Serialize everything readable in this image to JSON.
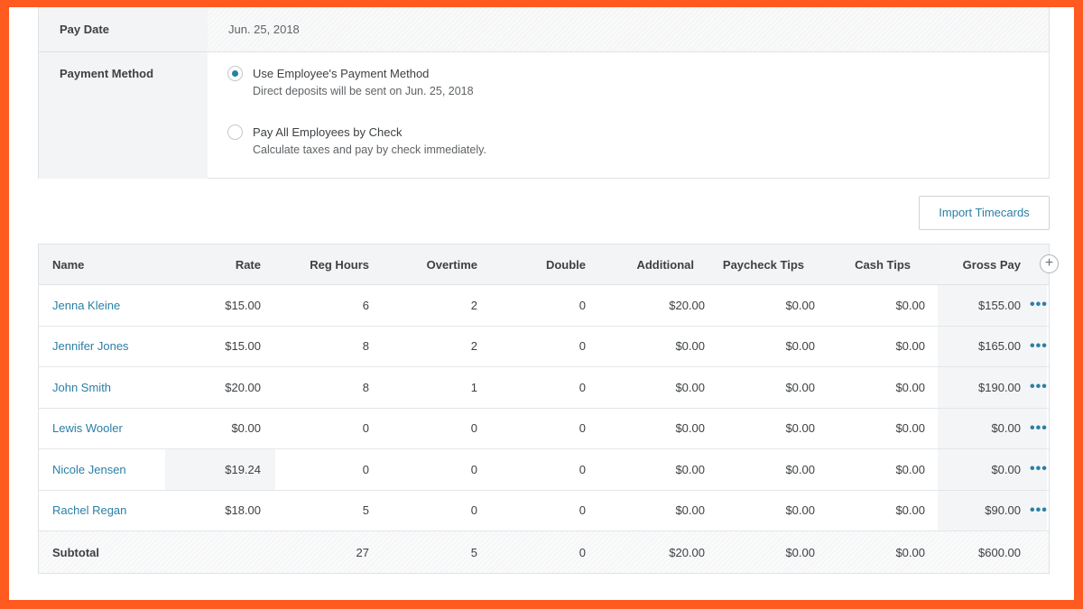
{
  "pay_date": {
    "label": "Pay Date",
    "value": "Jun. 25, 2018"
  },
  "payment_method": {
    "label": "Payment Method",
    "options": [
      {
        "title": "Use Employee's Payment Method",
        "description": "Direct deposits will be sent on Jun. 25, 2018",
        "selected": true
      },
      {
        "title": "Pay All Employees by Check",
        "description": "Calculate taxes and pay by check immediately.",
        "selected": false
      }
    ]
  },
  "import_button": "Import Timecards",
  "table": {
    "headers": [
      "Name",
      "Rate",
      "Reg Hours",
      "Overtime",
      "Double",
      "Additional",
      "Paycheck Tips",
      "Cash Tips",
      "Gross Pay"
    ],
    "add_column_icon": "plus-icon",
    "more_icon": "ellipsis-icon",
    "more_glyph": "•••",
    "rows": [
      {
        "name": "Jenna Kleine",
        "rate": "$15.00",
        "reg_hours": "6",
        "overtime": "2",
        "double": "0",
        "additional": "$20.00",
        "paycheck_tips": "$0.00",
        "cash_tips": "$0.00",
        "gross_pay": "$155.00"
      },
      {
        "name": "Jennifer Jones",
        "rate": "$15.00",
        "reg_hours": "8",
        "overtime": "2",
        "double": "0",
        "additional": "$0.00",
        "paycheck_tips": "$0.00",
        "cash_tips": "$0.00",
        "gross_pay": "$165.00"
      },
      {
        "name": "John Smith",
        "rate": "$20.00",
        "reg_hours": "8",
        "overtime": "1",
        "double": "0",
        "additional": "$0.00",
        "paycheck_tips": "$0.00",
        "cash_tips": "$0.00",
        "gross_pay": "$190.00"
      },
      {
        "name": "Lewis Wooler",
        "rate": "$0.00",
        "reg_hours": "0",
        "overtime": "0",
        "double": "0",
        "additional": "$0.00",
        "paycheck_tips": "$0.00",
        "cash_tips": "$0.00",
        "gross_pay": "$0.00"
      },
      {
        "name": "Nicole Jensen",
        "rate": "$19.24",
        "reg_hours": "0",
        "overtime": "0",
        "double": "0",
        "additional": "$0.00",
        "paycheck_tips": "$0.00",
        "cash_tips": "$0.00",
        "gross_pay": "$0.00"
      },
      {
        "name": "Rachel Regan",
        "rate": "$18.00",
        "reg_hours": "5",
        "overtime": "0",
        "double": "0",
        "additional": "$0.00",
        "paycheck_tips": "$0.00",
        "cash_tips": "$0.00",
        "gross_pay": "$90.00"
      }
    ],
    "subtotal": {
      "label": "Subtotal",
      "reg_hours": "27",
      "overtime": "5",
      "double": "0",
      "additional": "$20.00",
      "paycheck_tips": "$0.00",
      "cash_tips": "$0.00",
      "gross_pay": "$600.00"
    }
  },
  "colors": {
    "frame": "#ff5a1f",
    "link": "#2a7fa6",
    "label_bg": "#f3f4f5"
  }
}
